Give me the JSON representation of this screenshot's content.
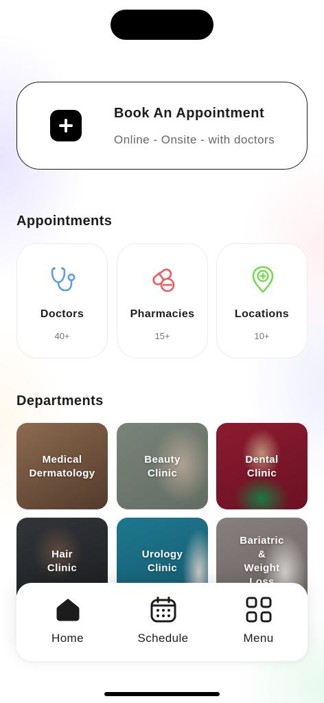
{
  "book": {
    "title": "Book An Appointment",
    "subtitle": "Online - Onsite - with doctors",
    "icon": "plus-icon"
  },
  "appointments": {
    "title": "Appointments",
    "items": [
      {
        "label": "Doctors",
        "count": "40+",
        "icon": "stethoscope-icon",
        "color": "#5b9bf0"
      },
      {
        "label": "Pharmacies",
        "count": "15+",
        "icon": "pills-icon",
        "color": "#ef5a5a"
      },
      {
        "label": "Locations",
        "count": "10+",
        "icon": "location-pin-icon",
        "color": "#6fdc4a"
      }
    ]
  },
  "departments": {
    "title": "Departments",
    "items": [
      {
        "name": "Medical\nDermatology",
        "color": "#8a6a52"
      },
      {
        "name": "Beauty\nClinic",
        "color": "#7e8a7c"
      },
      {
        "name": "Dental\nClinic",
        "color": "#8e1a30"
      },
      {
        "name": "Hair\nClinic",
        "color": "#2a2d31"
      },
      {
        "name": "Urology\nClinic",
        "color": "#1d7a93"
      },
      {
        "name": "Bariatric\n&\nWeight\nLoss",
        "color": "#8b8482"
      }
    ]
  },
  "tabbar": {
    "items": [
      {
        "label": "Home",
        "icon": "home-icon"
      },
      {
        "label": "Schedule",
        "icon": "calendar-icon"
      },
      {
        "label": "Menu",
        "icon": "grid-menu-icon"
      }
    ]
  }
}
